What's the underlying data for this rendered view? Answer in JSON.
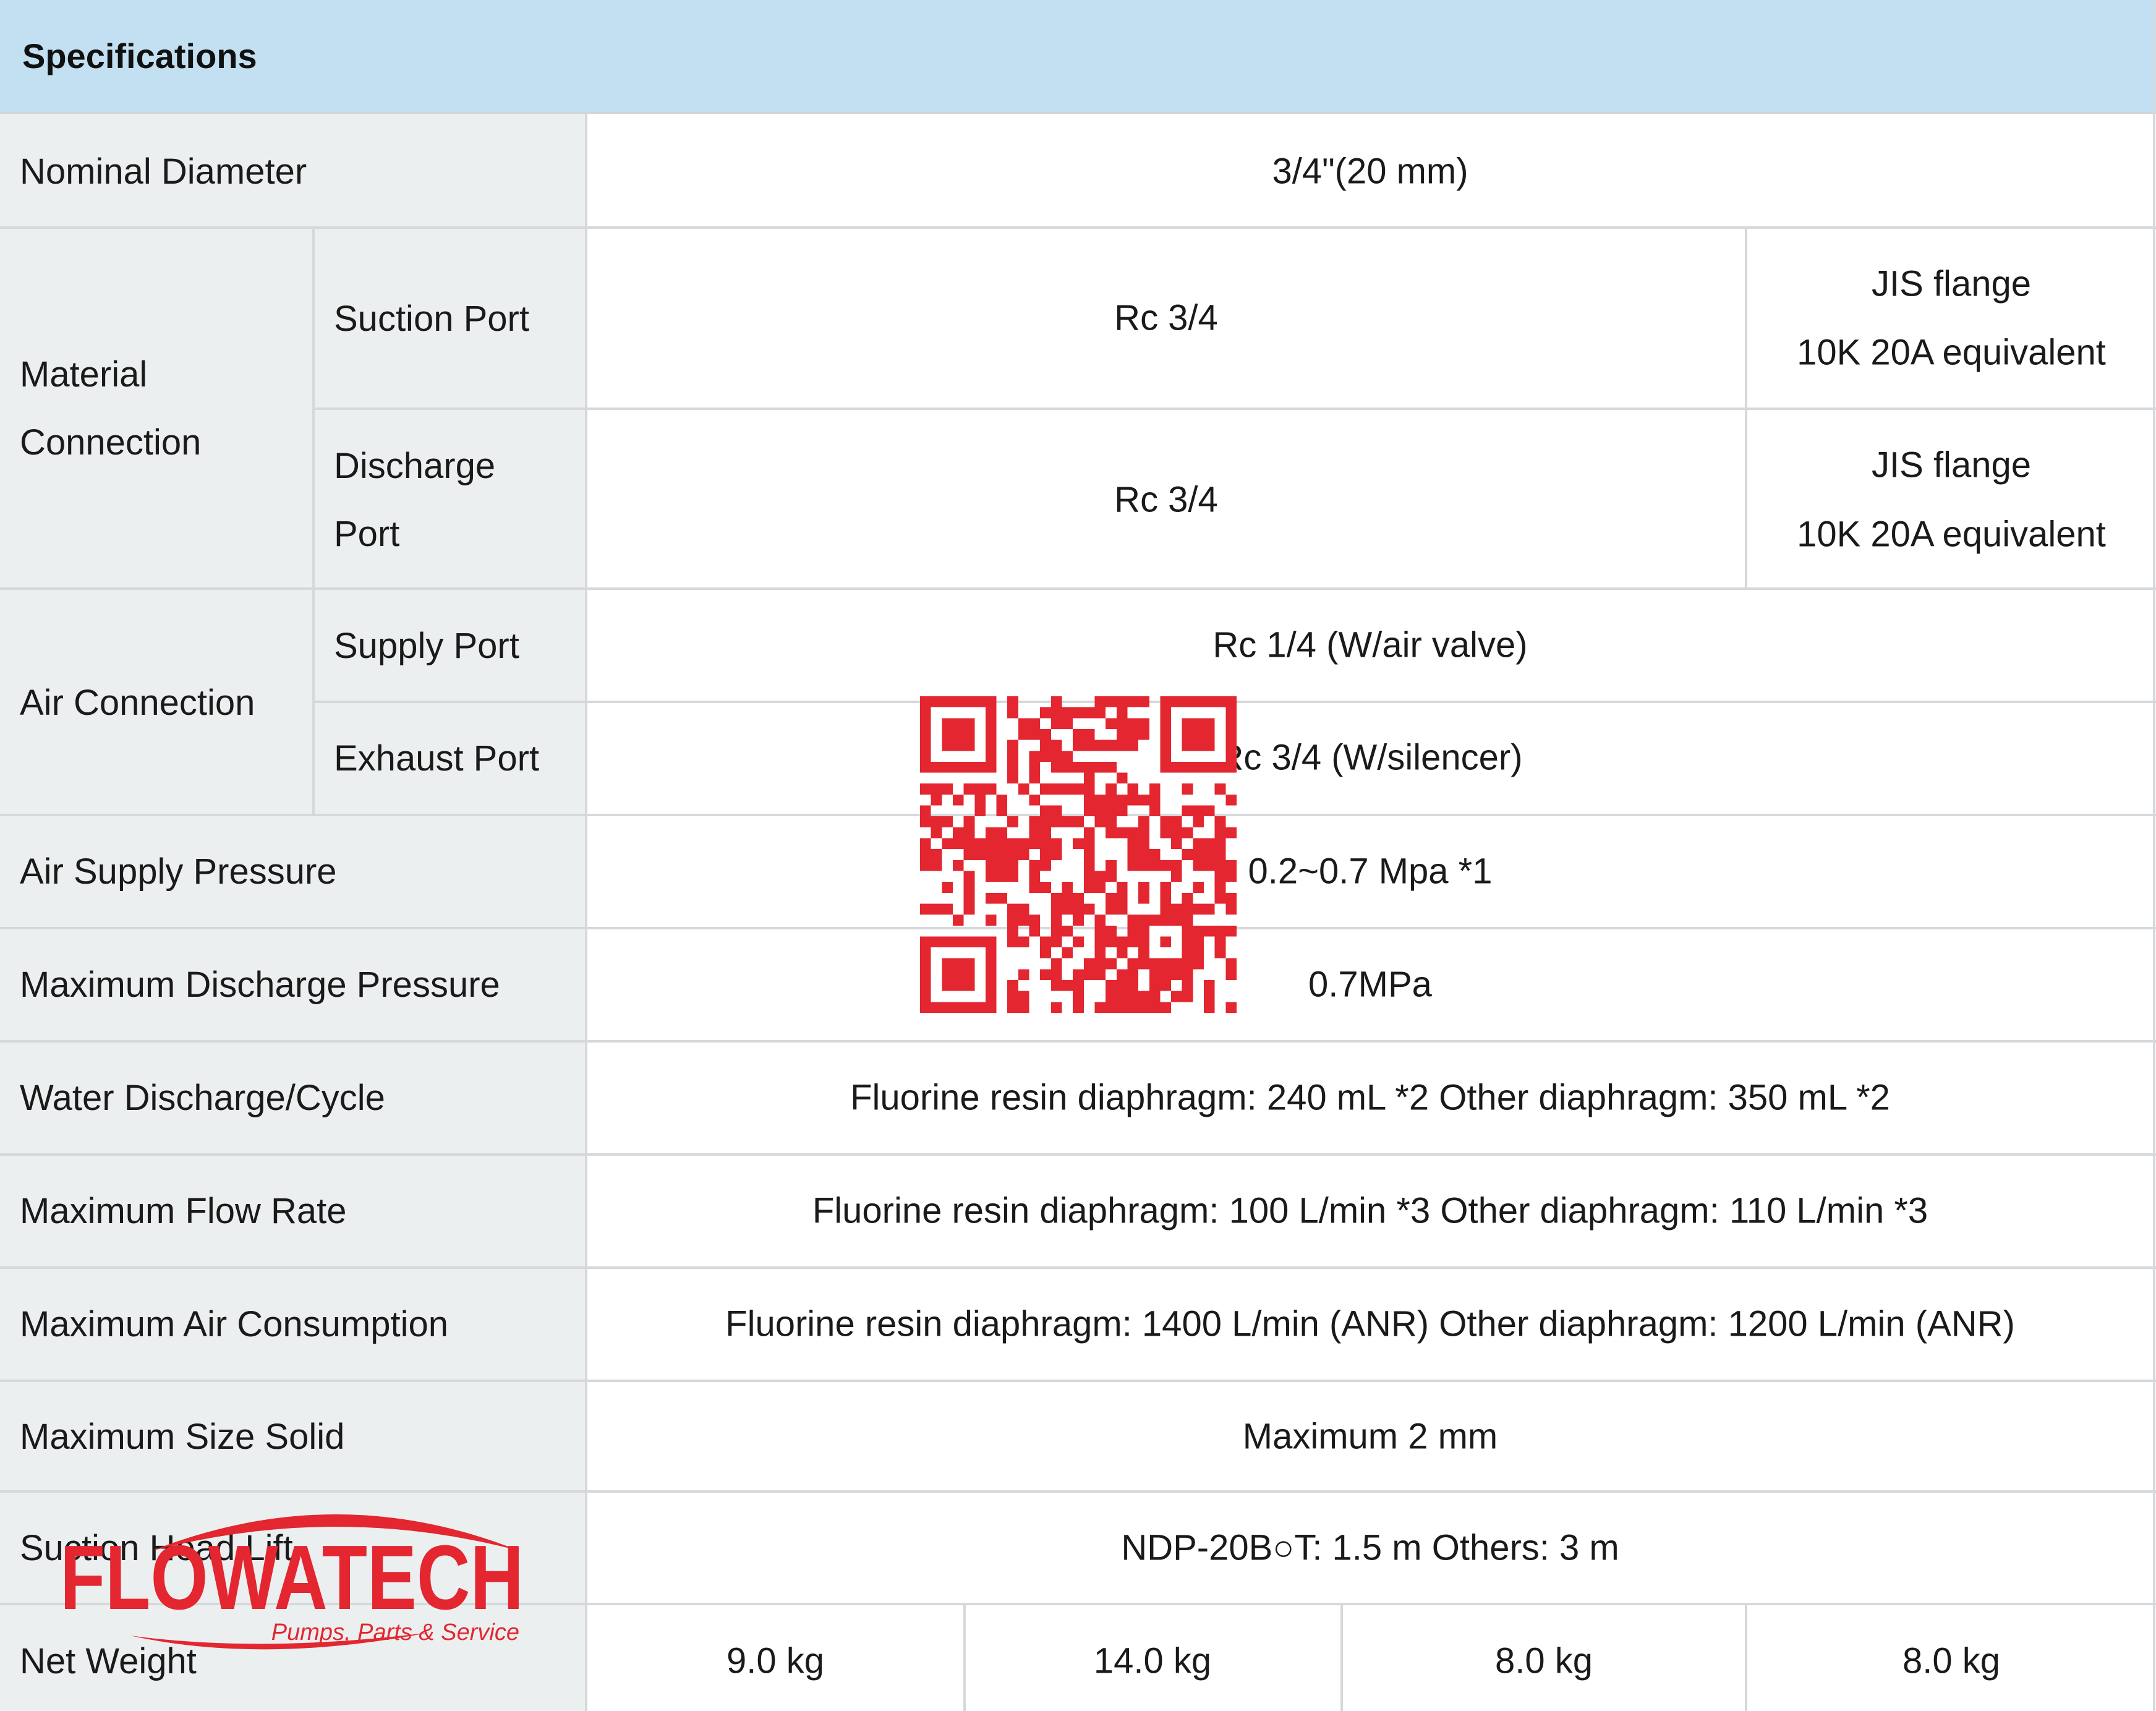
{
  "header": {
    "title": "Specifications"
  },
  "rows": {
    "nominal_diameter": {
      "label": "Nominal Diameter",
      "value": "3/4\"(20 mm)"
    },
    "material_connection": {
      "label_line1": "Material",
      "label_line2": "Connection",
      "suction": {
        "label": "Suction Port",
        "value": "Rc 3/4",
        "alt_line1": "JIS flange",
        "alt_line2": "10K 20A equivalent"
      },
      "discharge": {
        "label_line1": "Discharge",
        "label_line2": "Port",
        "value": "Rc 3/4",
        "alt_line1": "JIS flange",
        "alt_line2": "10K 20A equivalent"
      }
    },
    "air_connection": {
      "label": "Air Connection",
      "supply": {
        "label": "Supply Port",
        "value": "Rc 1/4 (W/air valve)"
      },
      "exhaust": {
        "label": "Exhaust Port",
        "value": "Rc 3/4 (W/silencer)"
      }
    },
    "air_supply_pressure": {
      "label": "Air Supply Pressure",
      "value": "0.2~0.7 Mpa *1"
    },
    "max_discharge_pressure": {
      "label": "Maximum Discharge Pressure",
      "value": "0.7MPa"
    },
    "water_discharge_cycle": {
      "label": "Water Discharge/Cycle",
      "value": "Fluorine resin diaphragm: 240 mL *2 Other diaphragm: 350 mL *2"
    },
    "max_flow_rate": {
      "label": "Maximum Flow Rate",
      "value": "Fluorine resin diaphragm: 100 L/min *3 Other diaphragm: 110 L/min *3"
    },
    "max_air_consumption": {
      "label": "Maximum Air Consumption",
      "value": "Fluorine resin diaphragm: 1400 L/min (ANR) Other diaphragm: 1200 L/min (ANR)"
    },
    "max_size_solid": {
      "label": "Maximum Size Solid",
      "value": "Maximum 2 mm"
    },
    "suction_head_lift": {
      "label": "Suction Head Lift",
      "value": "NDP-20B○T: 1.5 m Others: 3 m"
    },
    "net_weight": {
      "label": "Net Weight",
      "values": [
        "9.0 kg",
        "14.0 kg",
        "8.0 kg",
        "8.0 kg"
      ]
    }
  },
  "logo": {
    "brand": "FLOWATECH",
    "tagline": "Pumps, Parts & Service",
    "color": "#e3262f"
  },
  "qr": {
    "color": "#e3262f"
  },
  "colors": {
    "header_bg": "#c3e0f2",
    "label_bg": "#eceff0",
    "border": "#d5d9db"
  }
}
